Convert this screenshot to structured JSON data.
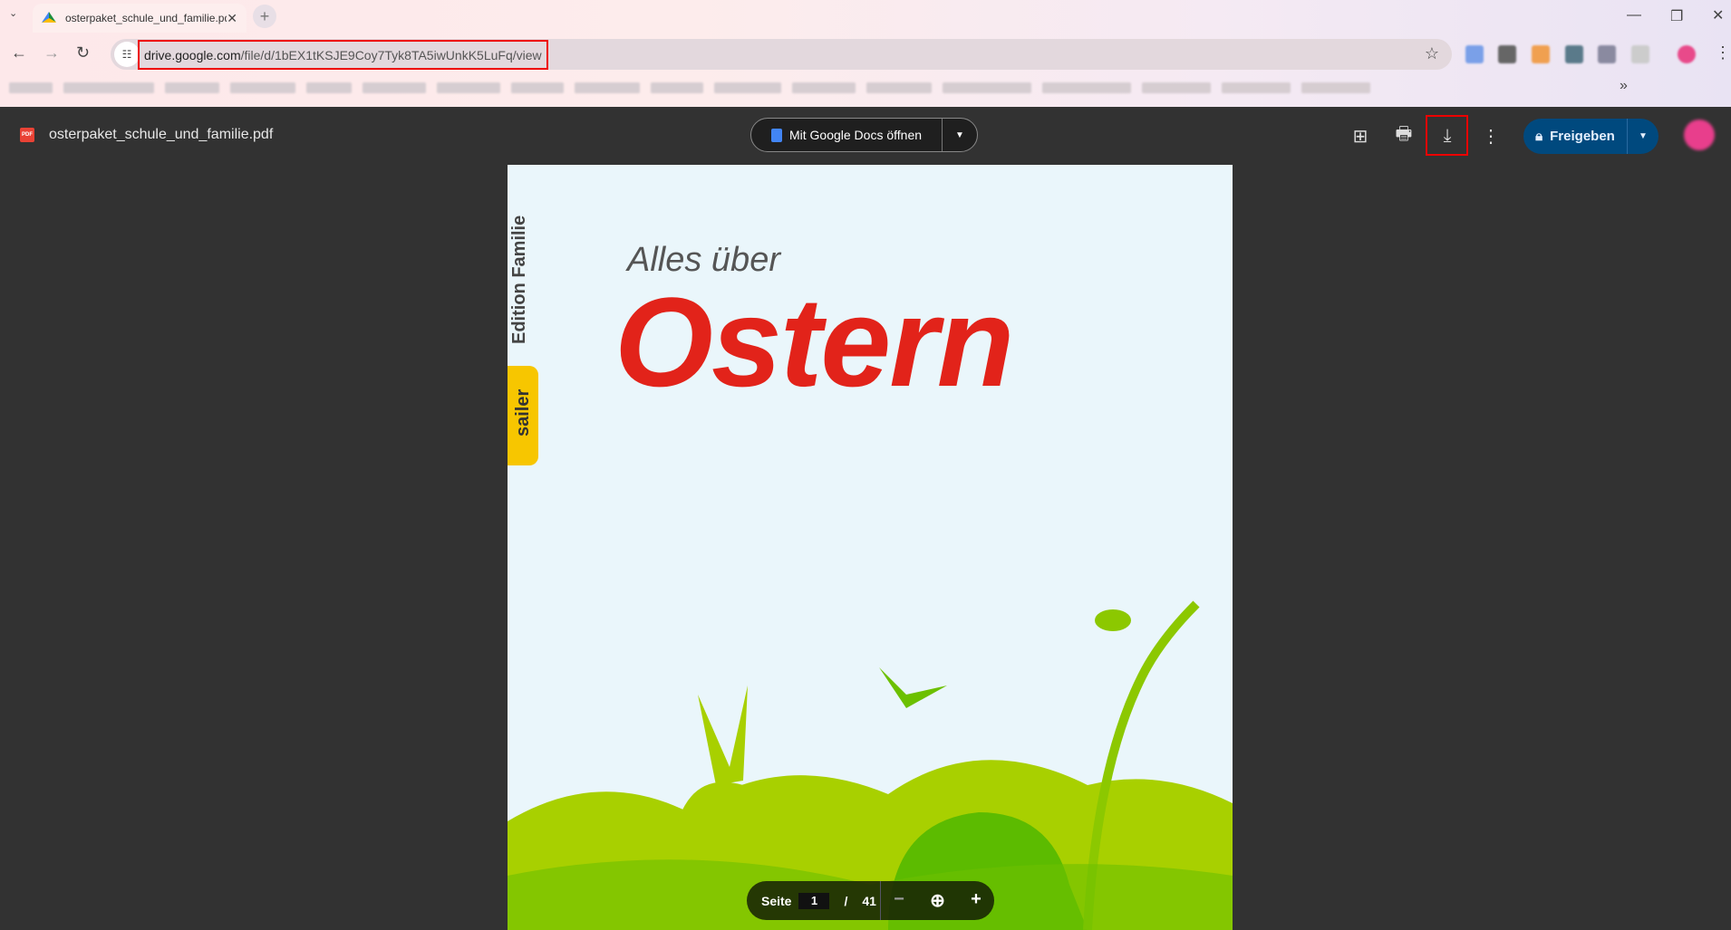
{
  "browser": {
    "tab_title": "osterpaket_schule_und_familie.pdf",
    "url_host": "drive.google.com",
    "url_path": "/file/d/1bEX1tKSJE9Coy7Tyk8TA5iwUnkK5LuFq/view",
    "highlight_color": "#e00000"
  },
  "viewer": {
    "file_name": "osterpaket_schule_und_familie.pdf",
    "pdf_badge": "PDF",
    "open_with": "Mit Google Docs öffnen",
    "share_label": "Freigeben"
  },
  "document": {
    "edition": "Edition Familie",
    "publisher": "sailer",
    "subtitle": "Alles über",
    "title": "Ostern",
    "title_color": "#e2231a"
  },
  "pager": {
    "label": "Seite",
    "current_page": "1",
    "separator": "/",
    "total_pages": "41"
  }
}
